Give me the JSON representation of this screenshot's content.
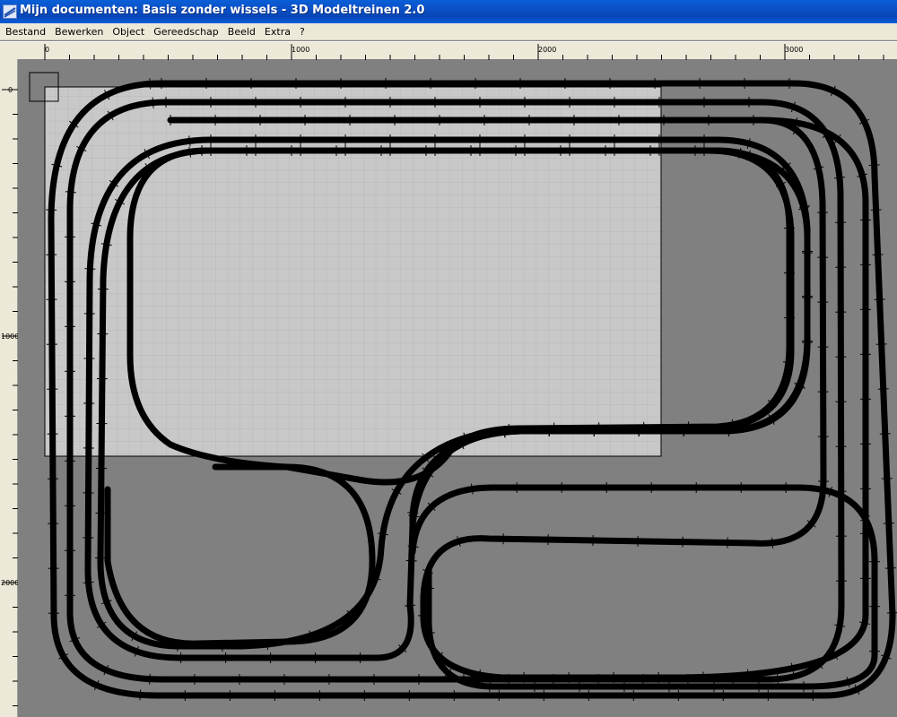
{
  "window": {
    "title": "Mijn documenten: Basis zonder wissels - 3D Modeltreinen 2.0",
    "icon": "track-app-icon"
  },
  "menu": [
    "Bestand",
    "Bewerken",
    "Object",
    "Gereedschap",
    "Beeld",
    "Extra",
    "?"
  ],
  "ruler": {
    "horizontal_labels": [
      "0",
      "1000",
      "2000",
      "3000"
    ],
    "vertical_labels": [
      "0",
      "1000",
      "2000"
    ]
  },
  "colors": {
    "workspace": "#808080",
    "baseboard": "#c8c8c8",
    "grid": "#b0b0b0",
    "track": "#000000",
    "titlebar": "#0a5fd8",
    "menubar": "#ece9d8"
  }
}
